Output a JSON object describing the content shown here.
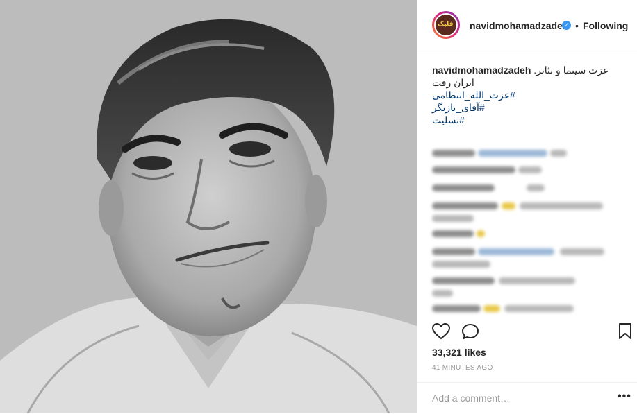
{
  "post": {
    "image_alt": "Black and white portrait",
    "header": {
      "avatar_text": "فلیک",
      "username": "navidmohamadzadeh",
      "verified_icon": "verified-badge-icon",
      "dot": "•",
      "follow_status": "Following"
    },
    "caption": {
      "username": "navidmohamadzadeh",
      "line1": "عزت سینما و تئاتر.",
      "line2": "ایران رفت",
      "hashtags": [
        "#عزت_الله_انتظامی",
        "#آقای_بازیگر",
        "#تسلیت"
      ]
    },
    "comments_note": "blurred",
    "actions": {
      "like_icon": "heart-icon",
      "comment_icon": "comment-icon",
      "save_icon": "bookmark-icon"
    },
    "likes": "33,321 likes",
    "time": "41 MINUTES AGO",
    "comment_input": {
      "placeholder": "Add a comment…"
    },
    "more_icon": "more-options-icon",
    "more_text": "•••"
  },
  "colors": {
    "hashtag": "#003569",
    "verified": "#3897f0",
    "muted": "#999999",
    "text": "#262626"
  }
}
